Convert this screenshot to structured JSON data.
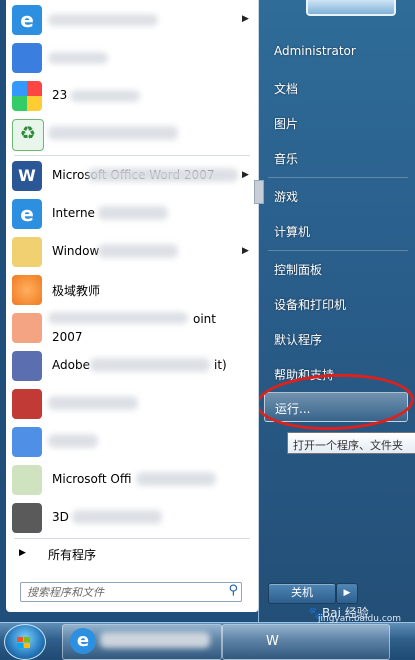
{
  "start_menu": {
    "right": {
      "user": "Administrator",
      "items": [
        "文档",
        "图片",
        "音乐",
        "游戏",
        "计算机",
        "控制面板",
        "设备和打印机",
        "默认程序",
        "帮助和支持"
      ],
      "run": "运行...",
      "tooltip": "打开一个程序、文件夹",
      "shutdown": "关机"
    },
    "programs": {
      "word": "Microsoft Office Word 2007",
      "ie": "Interne",
      "windows": "Window",
      "teacher": "极域教师",
      "ppt_line1": "oint",
      "ppt_line2": "2007",
      "adobe": "Adobe",
      "adobe_suffix": "it)",
      "office": "Microsoft Offi",
      "threed": "3D",
      "num": "23"
    },
    "all_programs": "所有程序",
    "search_placeholder": "搜索程序和文件"
  },
  "watermark": {
    "text": "Bai 经验",
    "url": "jingyan.baidu.com"
  },
  "taskbar": {
    "task_label": "W"
  }
}
